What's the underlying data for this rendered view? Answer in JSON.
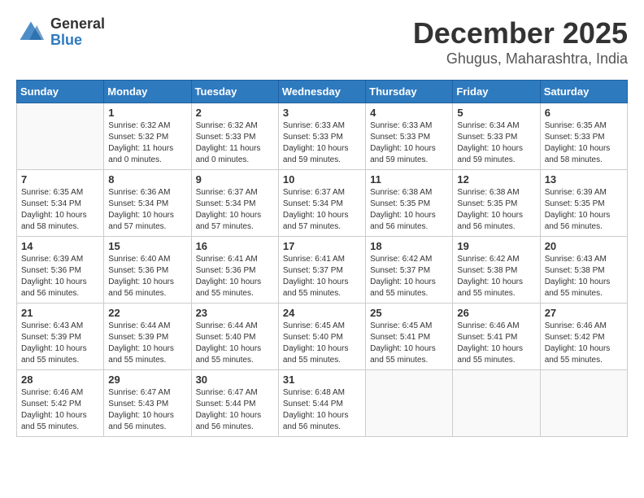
{
  "logo": {
    "general": "General",
    "blue": "Blue"
  },
  "header": {
    "month": "December 2025",
    "location": "Ghugus, Maharashtra, India"
  },
  "weekdays": [
    "Sunday",
    "Monday",
    "Tuesday",
    "Wednesday",
    "Thursday",
    "Friday",
    "Saturday"
  ],
  "weeks": [
    [
      {
        "day": "",
        "info": ""
      },
      {
        "day": "1",
        "info": "Sunrise: 6:32 AM\nSunset: 5:32 PM\nDaylight: 11 hours\nand 0 minutes."
      },
      {
        "day": "2",
        "info": "Sunrise: 6:32 AM\nSunset: 5:33 PM\nDaylight: 11 hours\nand 0 minutes."
      },
      {
        "day": "3",
        "info": "Sunrise: 6:33 AM\nSunset: 5:33 PM\nDaylight: 10 hours\nand 59 minutes."
      },
      {
        "day": "4",
        "info": "Sunrise: 6:33 AM\nSunset: 5:33 PM\nDaylight: 10 hours\nand 59 minutes."
      },
      {
        "day": "5",
        "info": "Sunrise: 6:34 AM\nSunset: 5:33 PM\nDaylight: 10 hours\nand 59 minutes."
      },
      {
        "day": "6",
        "info": "Sunrise: 6:35 AM\nSunset: 5:33 PM\nDaylight: 10 hours\nand 58 minutes."
      }
    ],
    [
      {
        "day": "7",
        "info": "Sunrise: 6:35 AM\nSunset: 5:34 PM\nDaylight: 10 hours\nand 58 minutes."
      },
      {
        "day": "8",
        "info": "Sunrise: 6:36 AM\nSunset: 5:34 PM\nDaylight: 10 hours\nand 57 minutes."
      },
      {
        "day": "9",
        "info": "Sunrise: 6:37 AM\nSunset: 5:34 PM\nDaylight: 10 hours\nand 57 minutes."
      },
      {
        "day": "10",
        "info": "Sunrise: 6:37 AM\nSunset: 5:34 PM\nDaylight: 10 hours\nand 57 minutes."
      },
      {
        "day": "11",
        "info": "Sunrise: 6:38 AM\nSunset: 5:35 PM\nDaylight: 10 hours\nand 56 minutes."
      },
      {
        "day": "12",
        "info": "Sunrise: 6:38 AM\nSunset: 5:35 PM\nDaylight: 10 hours\nand 56 minutes."
      },
      {
        "day": "13",
        "info": "Sunrise: 6:39 AM\nSunset: 5:35 PM\nDaylight: 10 hours\nand 56 minutes."
      }
    ],
    [
      {
        "day": "14",
        "info": "Sunrise: 6:39 AM\nSunset: 5:36 PM\nDaylight: 10 hours\nand 56 minutes."
      },
      {
        "day": "15",
        "info": "Sunrise: 6:40 AM\nSunset: 5:36 PM\nDaylight: 10 hours\nand 56 minutes."
      },
      {
        "day": "16",
        "info": "Sunrise: 6:41 AM\nSunset: 5:36 PM\nDaylight: 10 hours\nand 55 minutes."
      },
      {
        "day": "17",
        "info": "Sunrise: 6:41 AM\nSunset: 5:37 PM\nDaylight: 10 hours\nand 55 minutes."
      },
      {
        "day": "18",
        "info": "Sunrise: 6:42 AM\nSunset: 5:37 PM\nDaylight: 10 hours\nand 55 minutes."
      },
      {
        "day": "19",
        "info": "Sunrise: 6:42 AM\nSunset: 5:38 PM\nDaylight: 10 hours\nand 55 minutes."
      },
      {
        "day": "20",
        "info": "Sunrise: 6:43 AM\nSunset: 5:38 PM\nDaylight: 10 hours\nand 55 minutes."
      }
    ],
    [
      {
        "day": "21",
        "info": "Sunrise: 6:43 AM\nSunset: 5:39 PM\nDaylight: 10 hours\nand 55 minutes."
      },
      {
        "day": "22",
        "info": "Sunrise: 6:44 AM\nSunset: 5:39 PM\nDaylight: 10 hours\nand 55 minutes."
      },
      {
        "day": "23",
        "info": "Sunrise: 6:44 AM\nSunset: 5:40 PM\nDaylight: 10 hours\nand 55 minutes."
      },
      {
        "day": "24",
        "info": "Sunrise: 6:45 AM\nSunset: 5:40 PM\nDaylight: 10 hours\nand 55 minutes."
      },
      {
        "day": "25",
        "info": "Sunrise: 6:45 AM\nSunset: 5:41 PM\nDaylight: 10 hours\nand 55 minutes."
      },
      {
        "day": "26",
        "info": "Sunrise: 6:46 AM\nSunset: 5:41 PM\nDaylight: 10 hours\nand 55 minutes."
      },
      {
        "day": "27",
        "info": "Sunrise: 6:46 AM\nSunset: 5:42 PM\nDaylight: 10 hours\nand 55 minutes."
      }
    ],
    [
      {
        "day": "28",
        "info": "Sunrise: 6:46 AM\nSunset: 5:42 PM\nDaylight: 10 hours\nand 55 minutes."
      },
      {
        "day": "29",
        "info": "Sunrise: 6:47 AM\nSunset: 5:43 PM\nDaylight: 10 hours\nand 56 minutes."
      },
      {
        "day": "30",
        "info": "Sunrise: 6:47 AM\nSunset: 5:44 PM\nDaylight: 10 hours\nand 56 minutes."
      },
      {
        "day": "31",
        "info": "Sunrise: 6:48 AM\nSunset: 5:44 PM\nDaylight: 10 hours\nand 56 minutes."
      },
      {
        "day": "",
        "info": ""
      },
      {
        "day": "",
        "info": ""
      },
      {
        "day": "",
        "info": ""
      }
    ]
  ]
}
